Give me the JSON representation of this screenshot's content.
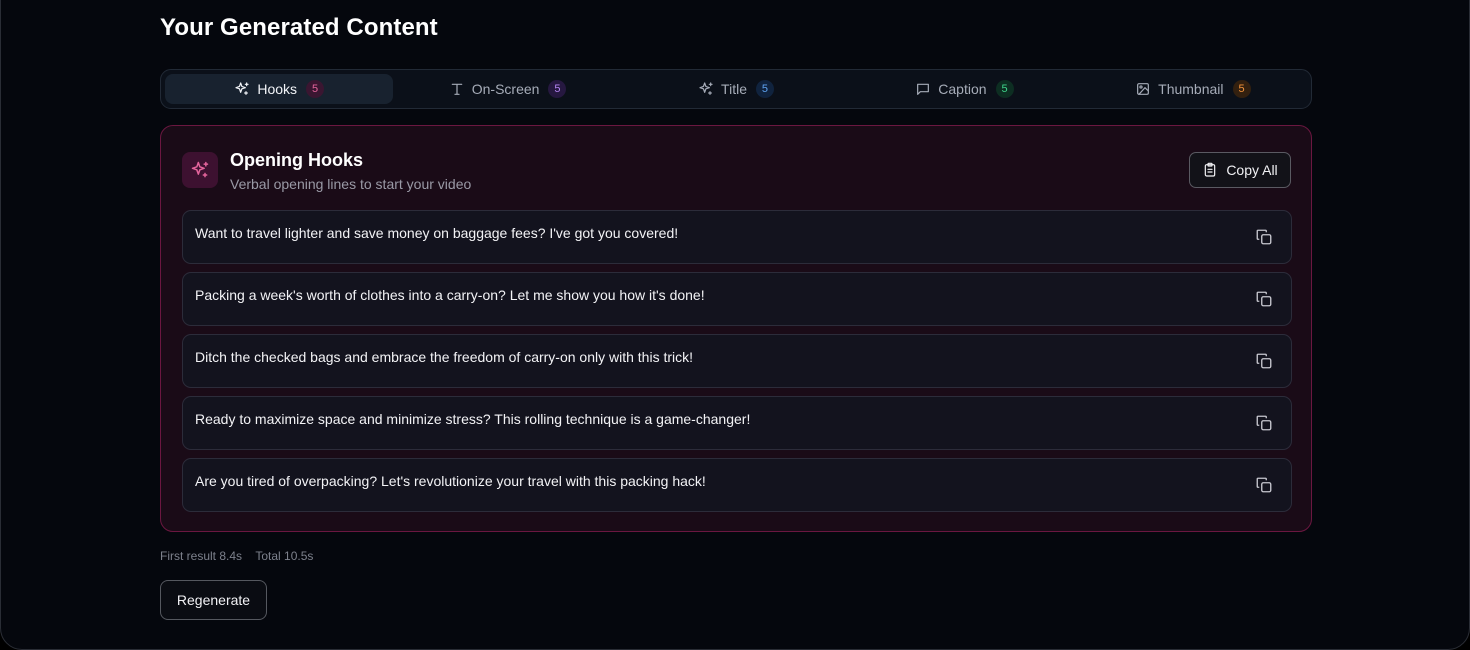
{
  "page_title": "Your Generated Content",
  "tabs": [
    {
      "label": "Hooks",
      "count": "5",
      "icon": "sparkles-icon",
      "active": true
    },
    {
      "label": "On-Screen",
      "count": "5",
      "icon": "text-icon",
      "active": false
    },
    {
      "label": "Title",
      "count": "5",
      "icon": "sparkles-icon",
      "active": false
    },
    {
      "label": "Caption",
      "count": "5",
      "icon": "message-square-icon",
      "active": false
    },
    {
      "label": "Thumbnail",
      "count": "5",
      "icon": "image-icon",
      "active": false
    }
  ],
  "panel": {
    "title": "Opening Hooks",
    "subtitle": "Verbal opening lines to start your video",
    "copy_all_label": "Copy All",
    "hooks": [
      "Want to travel lighter and save money on baggage fees? I've got you covered!",
      "Packing a week's worth of clothes into a carry-on? Let me show you how it's done!",
      "Ditch the checked bags and embrace the freedom of carry-on only with this trick!",
      "Ready to maximize space and minimize stress? This rolling technique is a game-changer!",
      "Are you tired of overpacking? Let's revolutionize your travel with this packing hack!"
    ]
  },
  "timing": {
    "first_result": "First result 8.4s",
    "total": "Total 10.5s"
  },
  "regenerate_label": "Regenerate",
  "colors": {
    "accent_pink": "#e4649c",
    "panel_border": "#6b1740",
    "background": "#05070d"
  }
}
